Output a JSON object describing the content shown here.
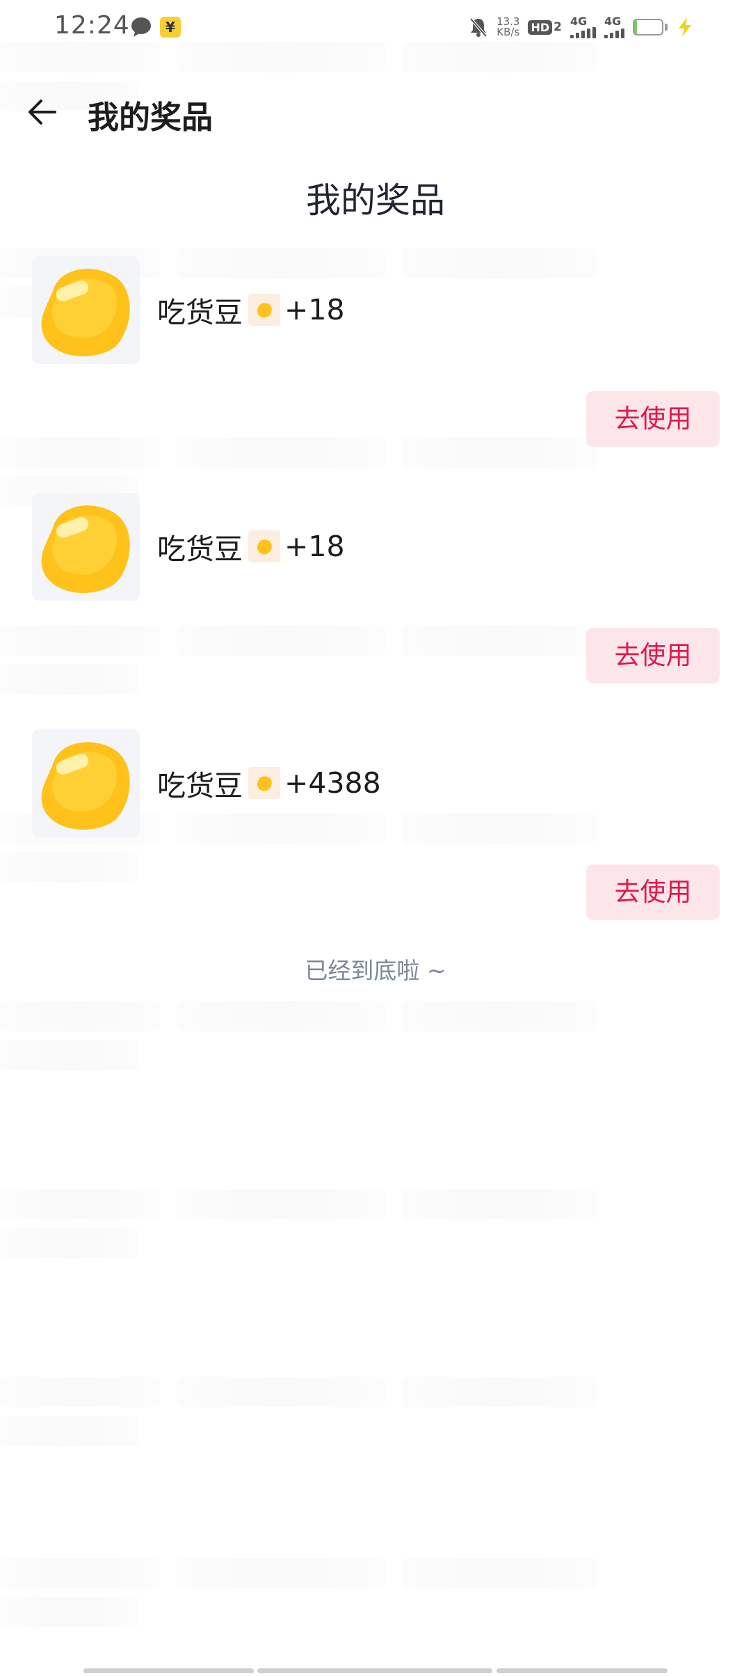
{
  "status_bar": {
    "time": "12:24",
    "net_speed_value": "13.3",
    "net_speed_unit": "KB/s",
    "hd_label": "HD",
    "hd_sim": "2",
    "network_1": "4G",
    "network_2": "4G",
    "battery_level": "10",
    "battery_fraction": 0.1
  },
  "nav": {
    "back_icon": "arrow-left-icon",
    "title": "我的奖品"
  },
  "section_title": "我的奖品",
  "prizes": [
    {
      "name": "吃货豆",
      "amount": "+18",
      "button_label": "去使用"
    },
    {
      "name": "吃货豆",
      "amount": "+18",
      "button_label": "去使用"
    },
    {
      "name": "吃货豆",
      "amount": "+4388",
      "button_label": "去使用"
    }
  ],
  "end_text": "已经到底啦 ~",
  "colors": {
    "accent": "#e2174b",
    "button_bg": "#fde6ea",
    "bean_yellow": "#ffc400",
    "muted_text": "#7b8797"
  }
}
